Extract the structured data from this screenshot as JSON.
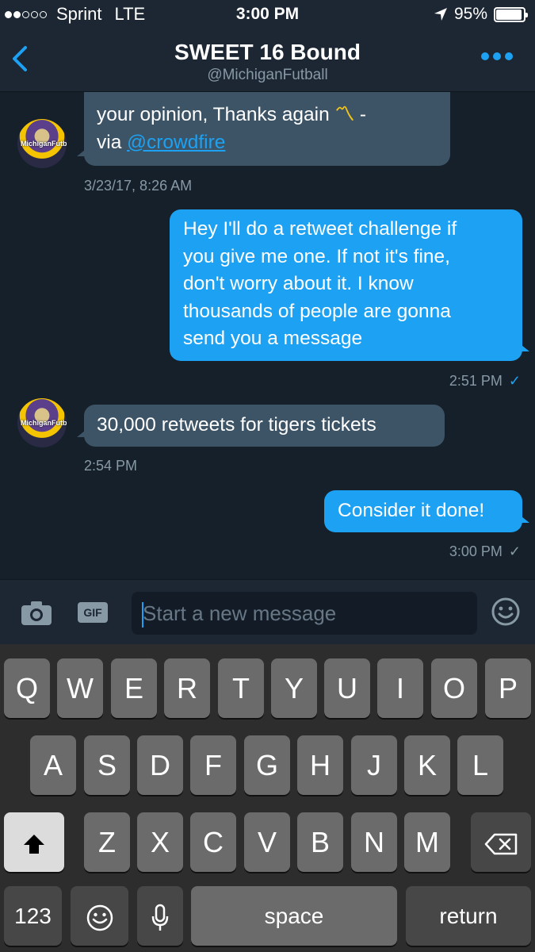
{
  "status_bar": {
    "carrier": "Sprint",
    "network": "LTE",
    "time": "3:00 PM",
    "battery": "95%",
    "battery_level": 0.95,
    "signal_dots_filled": 2,
    "signal_dots_total": 5
  },
  "nav": {
    "title": "SWEET 16 Bound",
    "handle": "@MichiganFutball"
  },
  "avatar_text": "MichiganFutball",
  "messages": [
    {
      "id": "m1",
      "direction": "incoming",
      "line1": "your opinion, Thanks again",
      "emoji": "〽",
      "line1_end": " -",
      "line2_prefix": "via ",
      "link": "@crowdfire",
      "timestamp": "3/23/17, 8:26 AM"
    },
    {
      "id": "m2",
      "direction": "outgoing",
      "lines": [
        "Hey I'll do a retweet challenge if",
        "you give me one. If not it's fine,",
        "don't worry about it. I know",
        "thousands of people are gonna",
        "send you a message"
      ],
      "timestamp": "2:51 PM",
      "check": "✓"
    },
    {
      "id": "m3",
      "direction": "incoming",
      "text": "30,000 retweets for tigers tickets",
      "timestamp": "2:54 PM"
    },
    {
      "id": "m4",
      "direction": "outgoing",
      "text": "Consider it done!",
      "timestamp": "3:00 PM",
      "check": "✓"
    }
  ],
  "composer": {
    "gif_label": "GIF",
    "placeholder": "Start a new message",
    "camera_icon": "camera-icon",
    "emoji_icon": "smiley-icon"
  },
  "keyboard": {
    "row1": [
      "Q",
      "W",
      "E",
      "R",
      "T",
      "Y",
      "U",
      "I",
      "O",
      "P"
    ],
    "row2": [
      "A",
      "S",
      "D",
      "F",
      "G",
      "H",
      "J",
      "K",
      "L"
    ],
    "row3": [
      "Z",
      "X",
      "C",
      "V",
      "B",
      "N",
      "M"
    ],
    "numbers_label": "123",
    "space_label": "space",
    "return_label": "return",
    "shift_icon": "shift-icon",
    "delete_icon": "delete-icon",
    "emoji_icon": "emoji-icon",
    "mic_icon": "microphone-icon"
  },
  "colors": {
    "accent": "#1da1f2",
    "background": "#15202b",
    "bar": "#1c2733",
    "incoming_bubble": "#3d5466",
    "key": "#6b6b6c"
  }
}
